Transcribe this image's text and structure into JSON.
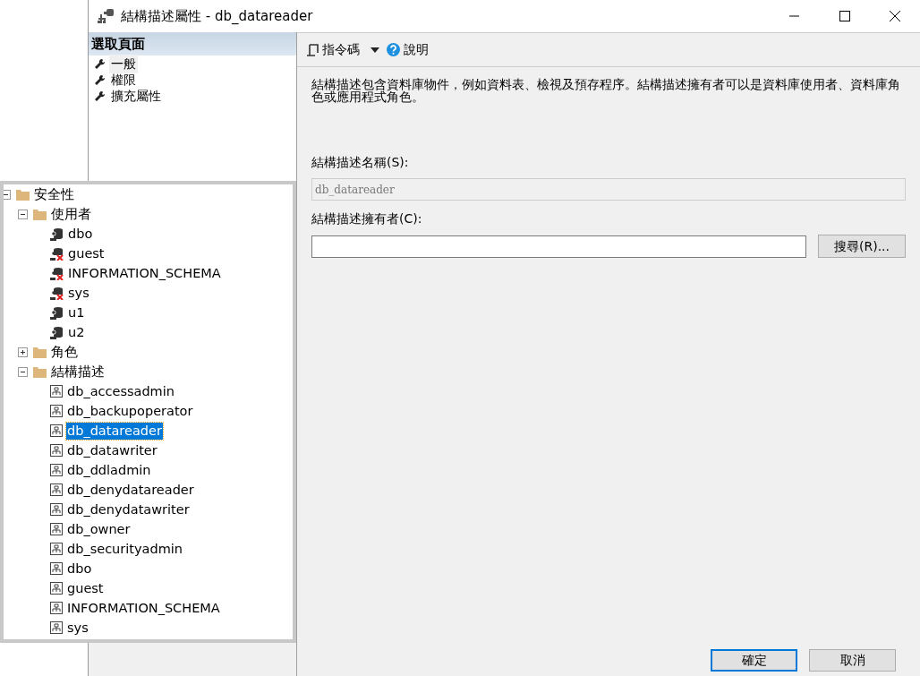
{
  "window": {
    "title": "結構描述屬性 - db_datareader"
  },
  "page_selector": {
    "header": "選取頁面",
    "items": [
      {
        "label": "一般",
        "selected": true
      },
      {
        "label": "權限",
        "selected": false
      },
      {
        "label": "擴充屬性",
        "selected": false
      }
    ]
  },
  "toolbar": {
    "script_label": "指令碼",
    "help_label": "說明"
  },
  "description": "結構描述包含資料庫物件，例如資料表、檢視及預存程序。結構描述擁有者可以是資料庫使用者、資料庫角色或應用程式角色。",
  "fields": [
    {
      "label": "結構描述名稱(S):",
      "value": "db_datareader",
      "disabled": true
    },
    {
      "label": "結構描述擁有者(C):",
      "disabled": false,
      "button": "搜尋(R)..."
    }
  ],
  "buttons": [
    {
      "label": "確定",
      "default": true
    },
    {
      "label": "取消",
      "default": false
    }
  ],
  "tree": [
    {
      "label": "安全性",
      "kind": "folder",
      "expanded": true,
      "selected": false,
      "children": [
        {
          "label": "使用者",
          "kind": "folder",
          "expanded": true,
          "selected": false,
          "children": [
            {
              "label": "dbo",
              "kind": "user",
              "selected": false
            },
            {
              "label": "guest",
              "kind": "user-disabled",
              "selected": false
            },
            {
              "label": "INFORMATION_SCHEMA",
              "kind": "user-disabled",
              "selected": false
            },
            {
              "label": "sys",
              "kind": "user-disabled",
              "selected": false
            },
            {
              "label": "u1",
              "kind": "user",
              "selected": false
            },
            {
              "label": "u2",
              "kind": "user",
              "selected": false
            }
          ]
        },
        {
          "label": "角色",
          "kind": "folder",
          "expanded": false,
          "selected": false
        },
        {
          "label": "結構描述",
          "kind": "folder",
          "expanded": true,
          "selected": false,
          "children": [
            {
              "label": "db_accessadmin",
              "kind": "schema",
              "selected": false
            },
            {
              "label": "db_backupoperator",
              "kind": "schema",
              "selected": false
            },
            {
              "label": "db_datareader",
              "kind": "schema",
              "selected": true
            },
            {
              "label": "db_datawriter",
              "kind": "schema",
              "selected": false
            },
            {
              "label": "db_ddladmin",
              "kind": "schema",
              "selected": false
            },
            {
              "label": "db_denydatareader",
              "kind": "schema",
              "selected": false
            },
            {
              "label": "db_denydatawriter",
              "kind": "schema",
              "selected": false
            },
            {
              "label": "db_owner",
              "kind": "schema",
              "selected": false
            },
            {
              "label": "db_securityadmin",
              "kind": "schema",
              "selected": false
            },
            {
              "label": "dbo",
              "kind": "schema",
              "selected": false
            },
            {
              "label": "guest",
              "kind": "schema",
              "selected": false
            },
            {
              "label": "INFORMATION_SCHEMA",
              "kind": "schema",
              "selected": false
            },
            {
              "label": "sys",
              "kind": "schema",
              "selected": false
            }
          ]
        }
      ]
    }
  ]
}
